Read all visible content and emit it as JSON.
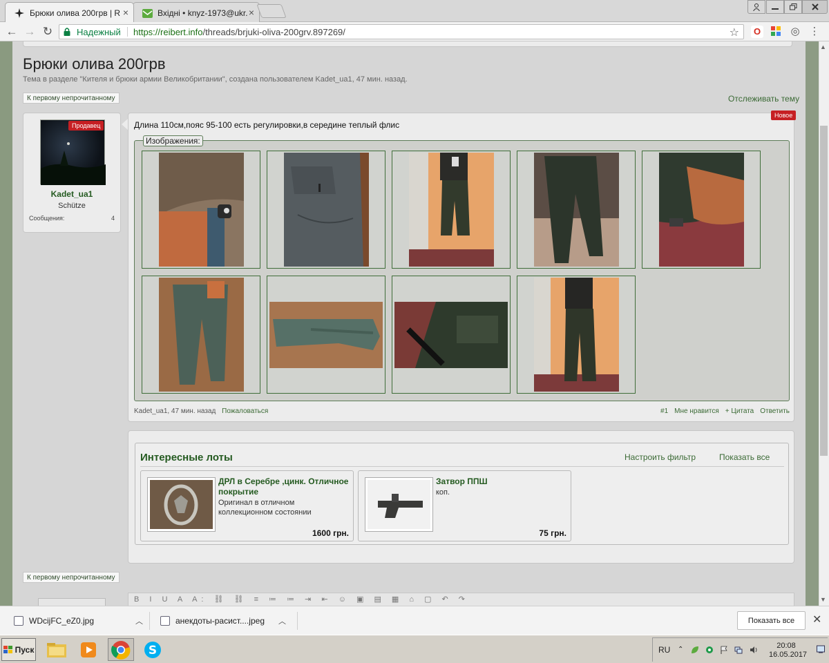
{
  "browser": {
    "tabs": [
      {
        "title": "Брюки олива 200грв | R"
      },
      {
        "title": "Вхідні • knyz-1973@ukr."
      }
    ],
    "security_label": "Надежный",
    "url_host": "https://reibert.info",
    "url_path": "/threads/brjuki-oliva-200grv.897269/"
  },
  "page": {
    "title": "Брюки олива 200грв",
    "subtitle": "Тема в разделе \"Кителя и брюки армии Великобритании\", создана пользователем Kadet_ua1, 47 мин. назад.",
    "first_unread_label": "К первому непрочитанному",
    "watch_thread_label": "Отслеживать тему",
    "user": {
      "seller_badge": "Продавец",
      "name": "Kadet_ua1",
      "rank": "Schütze",
      "messages_label": "Сообщения:",
      "messages_count": "4"
    },
    "post": {
      "new_badge": "Новое",
      "text": "Длина 110см,пояс 95-100 есть регулировки,в середине теплый флис",
      "images_label": "Изображения:",
      "meta": "Kadet_ua1, 47 мин. назад",
      "report_label": "Пожаловаться",
      "number": "#1",
      "like_label": "Мне нравится",
      "quote_label": "+ Цитата",
      "reply_label": "Ответить"
    },
    "lots": {
      "title": "Интересные лоты",
      "filter_label": "Настроить фильтр",
      "show_all_label": "Показать все",
      "items": [
        {
          "name": "ДРЛ в Серебре ,цинк. Отличное покрытие",
          "desc": "Оригинал в отличном коллекционном состоянии",
          "price": "1600 грн."
        },
        {
          "name": "Затвор ППШ",
          "desc": "коп.",
          "price": "75 грн."
        }
      ]
    }
  },
  "downloads": {
    "items": [
      {
        "name": "WDcijFC_eZ0.jpg"
      },
      {
        "name": "анекдоты-расист....jpeg"
      }
    ],
    "show_all_label": "Показать все"
  },
  "taskbar": {
    "start_label": "Пуск",
    "lang": "RU",
    "time": "20:08",
    "date": "16.05.2017"
  }
}
